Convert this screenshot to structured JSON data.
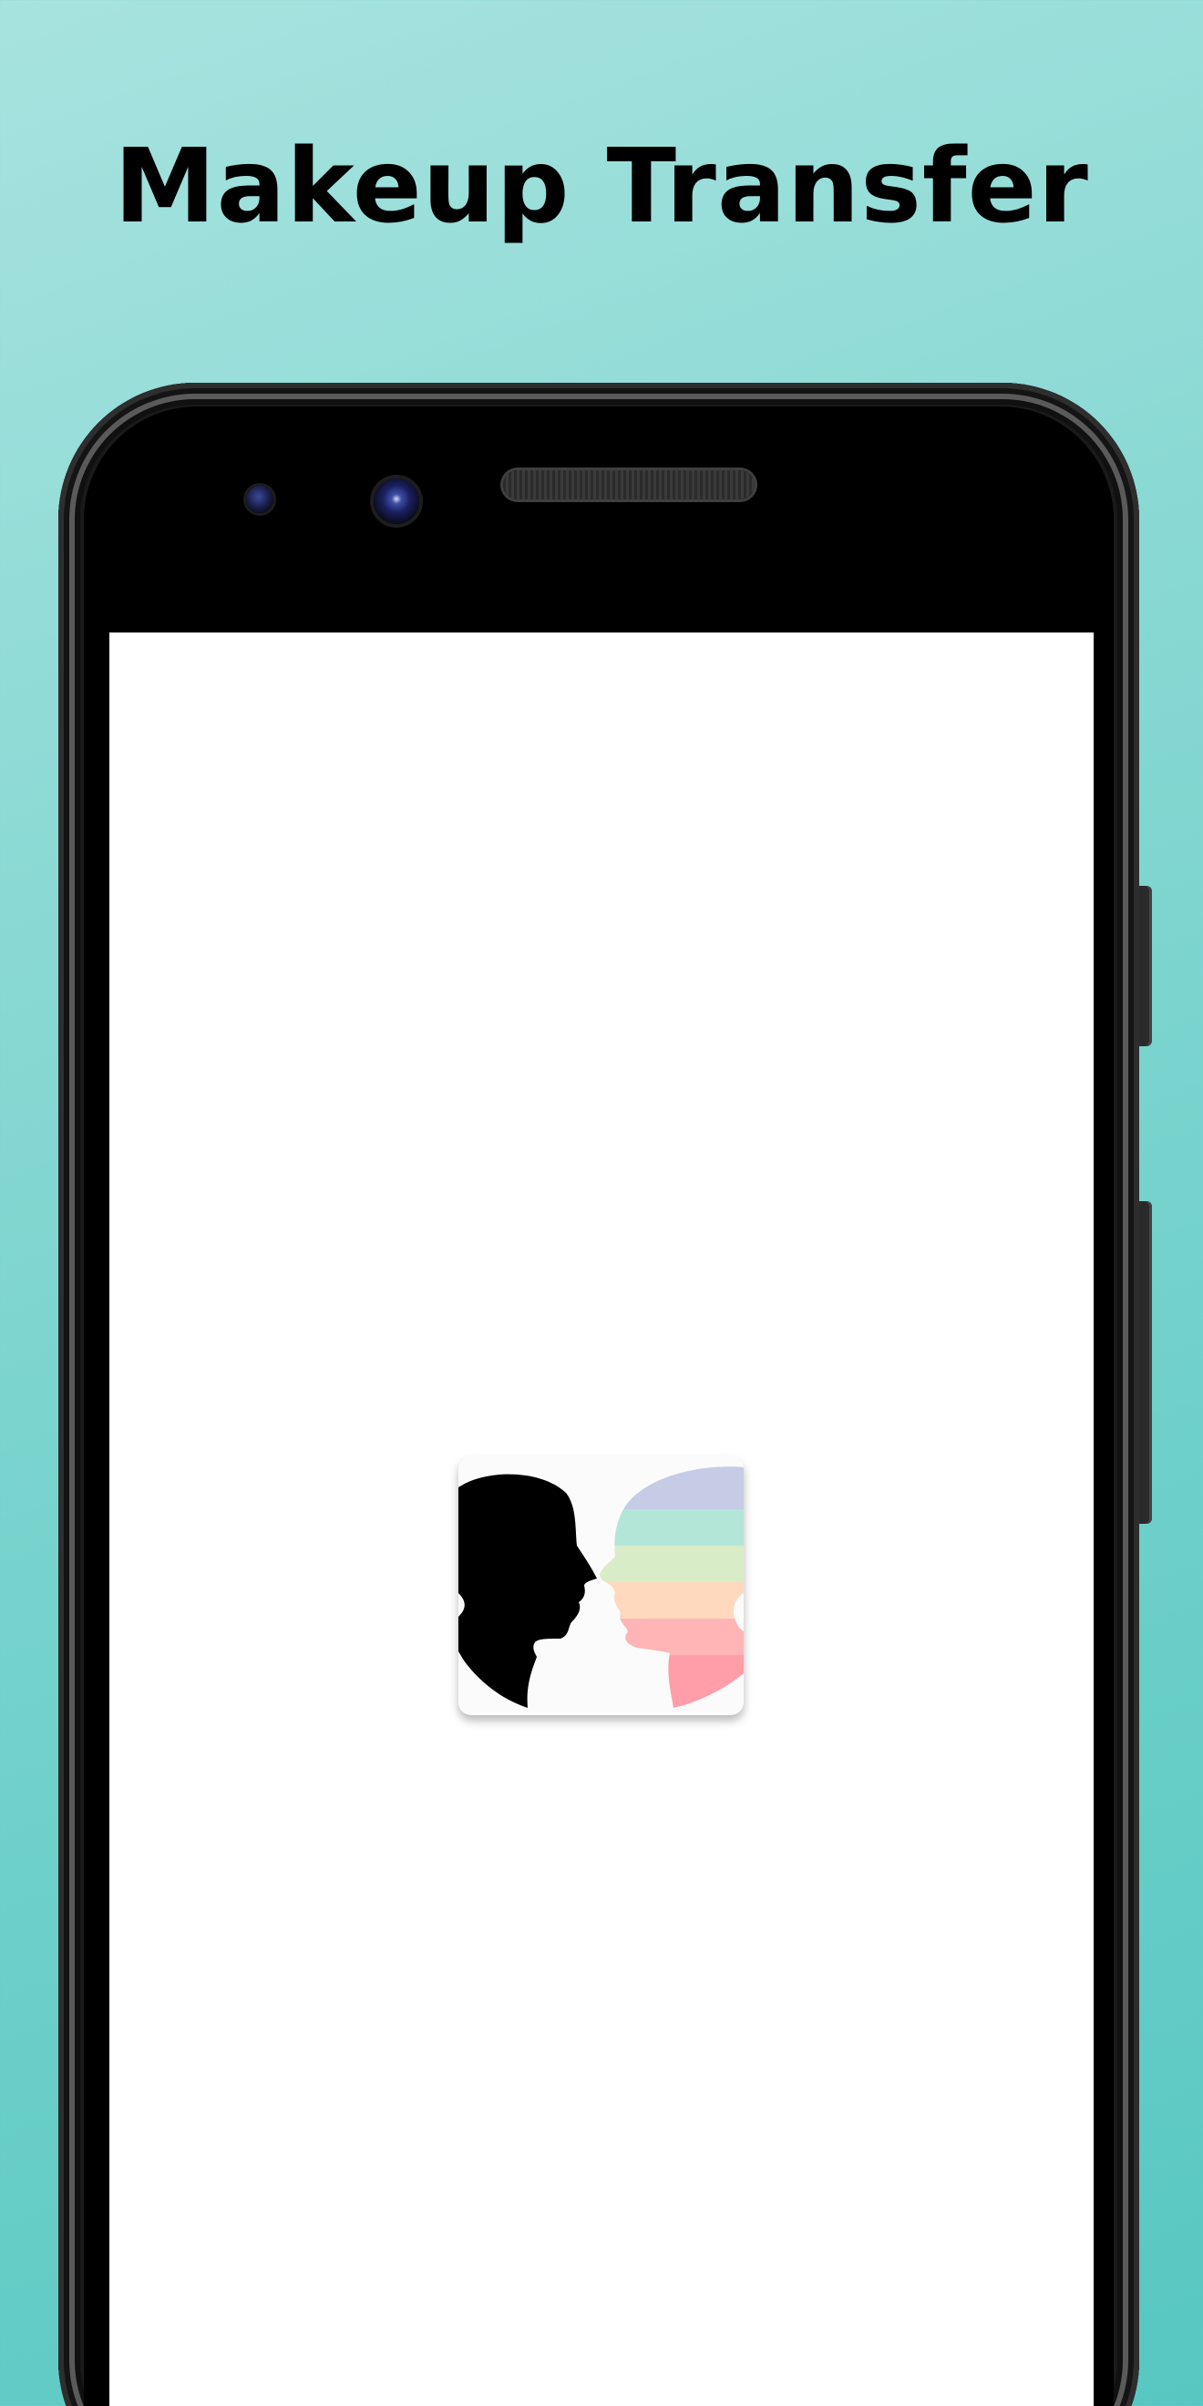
{
  "promo": {
    "headline": "Makeup Transfer"
  },
  "icons": {
    "app_logo": "two-face-silhouettes-icon",
    "front_camera": "camera-icon",
    "proximity_sensor": "sensor-icon",
    "earpiece": "speaker-grille-icon"
  },
  "colors": {
    "background_top": "#a7e3df",
    "background_bottom": "#58c7c1",
    "phone_body": "#1a1a1a",
    "screen": "#ffffff",
    "headline_text": "#000000",
    "stripe_colors": [
      "#c6cce6",
      "#b3e6d7",
      "#d9ecc8",
      "#ffd9bd",
      "#ffb5b5",
      "#ff9ea8"
    ]
  }
}
